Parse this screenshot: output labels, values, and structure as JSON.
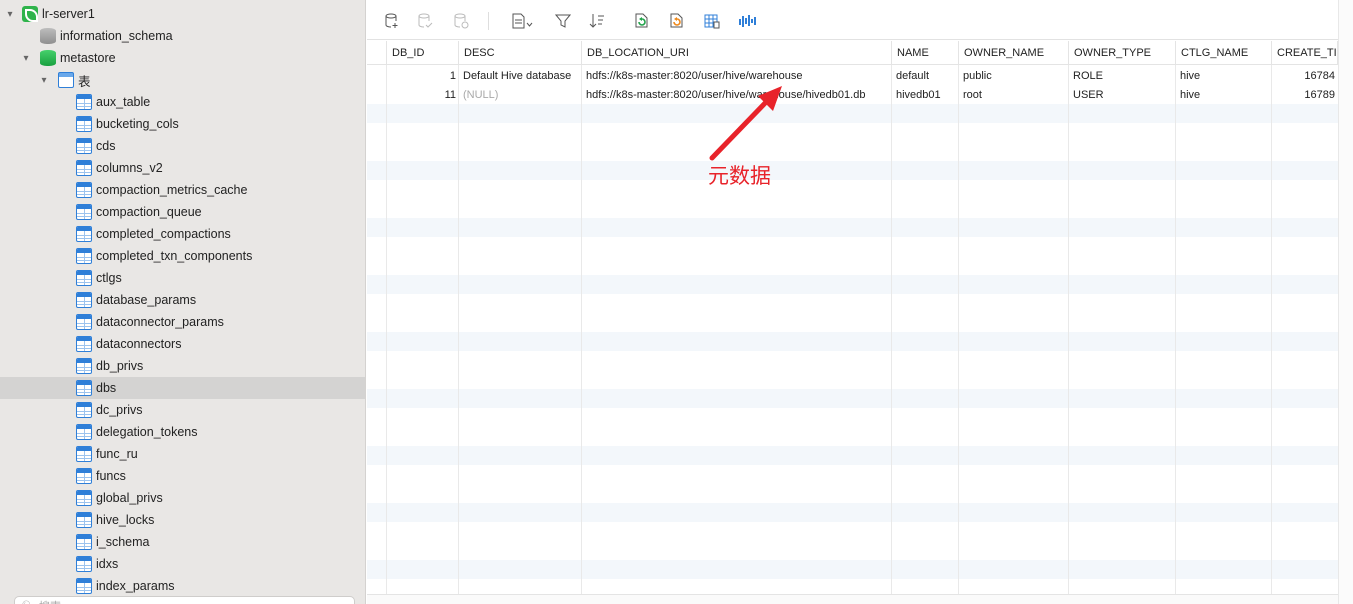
{
  "sidebar": {
    "server": "lr-server1",
    "db_info": "information_schema",
    "db_meta": "metastore",
    "tables_folder": "表",
    "tables": [
      "aux_table",
      "bucketing_cols",
      "cds",
      "columns_v2",
      "compaction_metrics_cache",
      "compaction_queue",
      "completed_compactions",
      "completed_txn_components",
      "ctlgs",
      "database_params",
      "dataconnector_params",
      "dataconnectors",
      "db_privs",
      "dbs",
      "dc_privs",
      "delegation_tokens",
      "func_ru",
      "funcs",
      "global_privs",
      "hive_locks",
      "i_schema",
      "idxs",
      "index_params"
    ],
    "selected_table": "dbs",
    "search_placeholder": "搜索"
  },
  "toolbar": {
    "icons": [
      "add-row-icon",
      "save-row-icon",
      "discard-row-icon",
      "export-icon",
      "filter-icon",
      "sort-icon",
      "refresh-green-icon",
      "refresh-orange-icon",
      "grid-view-icon",
      "chart-icon"
    ]
  },
  "grid": {
    "columns": [
      "DB_ID",
      "DESC",
      "DB_LOCATION_URI",
      "NAME",
      "OWNER_NAME",
      "OWNER_TYPE",
      "CTLG_NAME",
      "CREATE_TIM"
    ],
    "rows": [
      [
        "1",
        "Default Hive database",
        "hdfs://k8s-master:8020/user/hive/warehouse",
        "default",
        "public",
        "ROLE",
        "hive",
        "16784"
      ],
      [
        "11",
        "(NULL)",
        "hdfs://k8s-master:8020/user/hive/warehouse/hivedb01.db",
        "hivedb01",
        "root",
        "USER",
        "hive",
        "16789"
      ]
    ]
  },
  "annotation": {
    "label": "元数据",
    "color": "#e8232a"
  },
  "colors": {
    "table_icon": "#2f7fd8",
    "db_green": "#1fb14a",
    "selected_row": "#d4d3d2",
    "stripe": "#f3f7fb"
  }
}
